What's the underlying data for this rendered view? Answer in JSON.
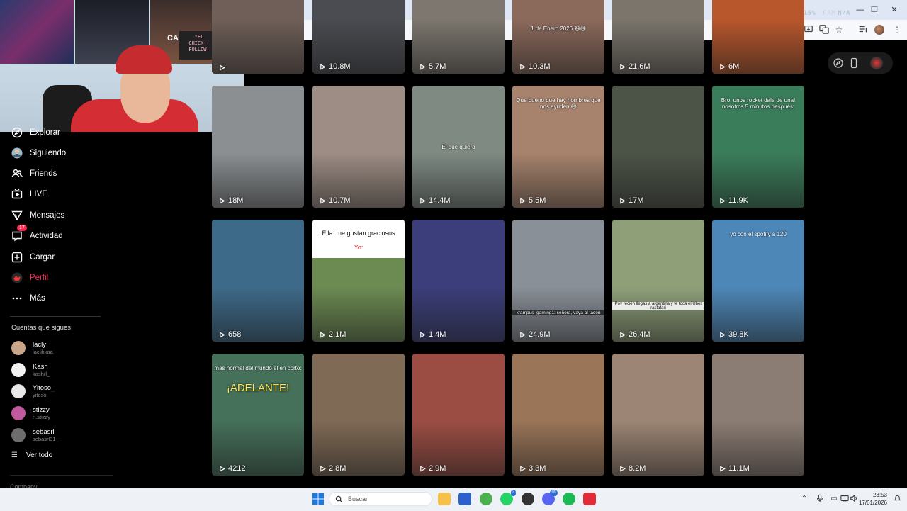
{
  "browser": {
    "perf_overlay": [
      {
        "label": "FPS",
        "value": "N/A"
      },
      {
        "label": "GPU",
        "value": "11%"
      },
      {
        "label": "CPU",
        "value": "15%"
      },
      {
        "label": "RAM",
        "value": "N/A"
      }
    ]
  },
  "webcam": {
    "sign_line1": "*EL",
    "sign_line2": "CHICK!!",
    "sign_line3": "FOLLOW!",
    "poster_text": "CAL"
  },
  "sidebar": {
    "items": [
      {
        "label": "Explorar",
        "icon": "compass-icon"
      },
      {
        "label": "Siguiendo",
        "icon": "following-avatar-icon"
      },
      {
        "label": "Friends",
        "icon": "friends-icon"
      },
      {
        "label": "LIVE",
        "icon": "live-tv-icon"
      },
      {
        "label": "Mensajes",
        "icon": "paper-plane-icon"
      },
      {
        "label": "Actividad",
        "icon": "activity-icon",
        "badge": "17"
      },
      {
        "label": "Cargar",
        "icon": "upload-plus-icon"
      },
      {
        "label": "Perfil",
        "icon": "profile-avatar-icon",
        "active": true
      },
      {
        "label": "Más",
        "icon": "more-dots-icon"
      }
    ],
    "following_title": "Cuentas que sigues",
    "accounts": [
      {
        "name": "lacly",
        "username": "laclikkaa",
        "avatar_color": "#c9a58a"
      },
      {
        "name": "Kash",
        "username": "kashrl_",
        "avatar_color": "#f2f2f2"
      },
      {
        "name": "Yitoso_",
        "username": "yitoso_",
        "avatar_color": "#e8e8e8"
      },
      {
        "name": "stizzy",
        "username": "rl.stizzy",
        "avatar_color": "#c05a9c"
      },
      {
        "name": "sebasrl",
        "username": "sebasrl31_",
        "avatar_color": "#6d6d6d"
      }
    ],
    "see_all": "Ver todo",
    "company": "Company"
  },
  "colors": {
    "accent": "#fe2c55",
    "background": "#000000"
  },
  "videos": [
    {
      "views": "",
      "bg": "#6f5f58",
      "caption": ""
    },
    {
      "views": "10.8M",
      "bg": "#4b4c52",
      "caption": ""
    },
    {
      "views": "5.7M",
      "bg": "#7d776f",
      "caption": ""
    },
    {
      "views": "10.3M",
      "bg": "#8b6a5c",
      "caption": "1 de Enero 2026 😄😄"
    },
    {
      "views": "21.6M",
      "bg": "#7b756c",
      "caption": ""
    },
    {
      "views": "6M",
      "bg": "#b9572c",
      "caption": ""
    },
    {
      "views": "18M",
      "bg": "#8b8f92",
      "caption": ""
    },
    {
      "views": "10.7M",
      "bg": "#9d8d84",
      "caption": ""
    },
    {
      "views": "14.4M",
      "bg": "#7f8a83",
      "caption": "El que quiero"
    },
    {
      "views": "5.5M",
      "bg": "#a7836d",
      "caption": "Que bueno que hay hombres que nos ayuden 😄"
    },
    {
      "views": "17M",
      "bg": "#4c5347",
      "caption": ""
    },
    {
      "views": "11.9K",
      "bg": "#3a7d5a",
      "caption": "Bro, unos rocket dale de una! nosotros 5 minutos después:"
    },
    {
      "views": "658",
      "bg": "#3e6a89",
      "caption": ""
    },
    {
      "views": "2.1M",
      "bg": "#6c8b52",
      "caption": "Ella: me gustan graciosos",
      "caption2": "Yo:"
    },
    {
      "views": "1.4M",
      "bg": "#3b3e7a",
      "caption": ""
    },
    {
      "views": "24.9M",
      "bg": "#8a9098",
      "caption": "krampus_gaming1: señora, vaya al tacón"
    },
    {
      "views": "26.4M",
      "bg": "#8fa079",
      "caption": "Pov recién llegas a argentina y te toca el Uber rastafari"
    },
    {
      "views": "39.8K",
      "bg": "#4d87b8",
      "caption": "yo con el spotify a 120"
    },
    {
      "views": "4212",
      "bg": "#45705a",
      "caption": "más normal del mundo el en corto:",
      "caption2": "¡ADELANTE!"
    },
    {
      "views": "2.8M",
      "bg": "#7f6a55",
      "caption": ""
    },
    {
      "views": "2.9M",
      "bg": "#9c4d43",
      "caption": ""
    },
    {
      "views": "3.3M",
      "bg": "#9a7558",
      "caption": ""
    },
    {
      "views": "8.2M",
      "bg": "#9c8574",
      "caption": ""
    },
    {
      "views": "11.1M",
      "bg": "#8c7d74",
      "caption": ""
    }
  ],
  "taskbar": {
    "search_placeholder": "Buscar",
    "apps": [
      {
        "name": "file-explorer-icon",
        "color": "#f5c14a"
      },
      {
        "name": "store-icon",
        "color": "#2a62c9"
      },
      {
        "name": "chrome-icon",
        "color": "#4caf50"
      },
      {
        "name": "whatsapp-icon",
        "color": "#25d366",
        "badge": "2"
      },
      {
        "name": "app-icon",
        "color": "#333333"
      },
      {
        "name": "discord-icon",
        "color": "#5865f2",
        "badge": "99"
      },
      {
        "name": "spotify-icon",
        "color": "#1db954"
      },
      {
        "name": "red-app-icon",
        "color": "#e02b3a"
      }
    ],
    "time": "23:53",
    "date": "17/01/2026"
  }
}
